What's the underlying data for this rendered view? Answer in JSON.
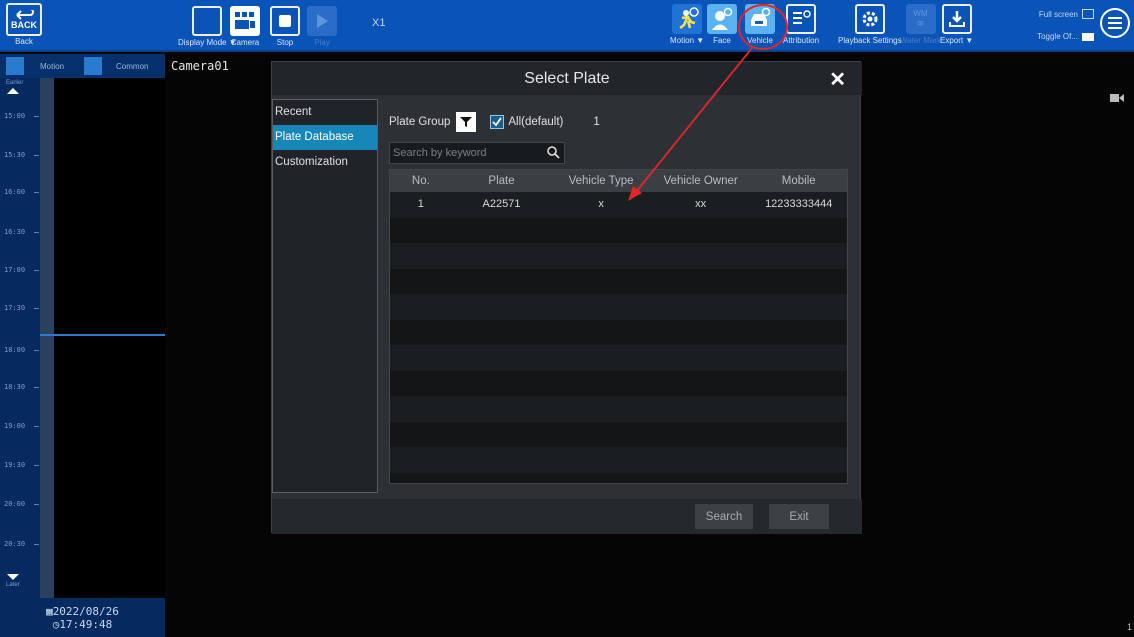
{
  "toolbar": {
    "back_icon_text": "BACK",
    "back_label": "Back",
    "display_mode_label": "Display Mode ▼",
    "camera_label": "Camera",
    "stop_label": "Stop",
    "play_label": "Play",
    "speed": "X1",
    "motion_label": "Motion ▼",
    "face_label": "Face",
    "vehicle_label": "Vehicle",
    "attribution_label": "Attribution",
    "playback_settings_label": "Playback Settings",
    "watermark_icon_text": "WM",
    "watermark_label": "Water Mark",
    "export_label": "Export ▼",
    "fullscreen_label": "Full screen",
    "toggle_label": "Toggle Of...",
    "colors": {
      "bar": "#0a54b8",
      "highlight_circle": "#e2262a"
    }
  },
  "sidebar": {
    "motion_tab": "Motion",
    "common_tab": "Common",
    "earlier_label": "Earlier",
    "later_label": "Later",
    "times": [
      "15:00",
      "15:30",
      "16:00",
      "16:30",
      "17:00",
      "17:30",
      "18:00",
      "18:30",
      "19:00",
      "19:30",
      "20:00",
      "20:30"
    ],
    "date": "2022/08/26",
    "time": "17:49:48"
  },
  "camera": {
    "name": "Camera01"
  },
  "corner_number": "1",
  "dialog": {
    "title": "Select Plate",
    "nav": [
      "Recent",
      "Plate Database",
      "Customization"
    ],
    "active_nav": "Plate Database",
    "plate_group_label": "Plate Group",
    "all_default_label": "All(default)",
    "count": "1",
    "search_placeholder": "Search by keyword",
    "columns": [
      "No.",
      "Plate",
      "Vehicle Type",
      "Vehicle Owner",
      "Mobile"
    ],
    "rows": [
      [
        "1",
        "A22571",
        "x",
        "xx",
        "12233333444"
      ]
    ],
    "empty_rows": 11,
    "search_button": "Search",
    "exit_button": "Exit"
  }
}
